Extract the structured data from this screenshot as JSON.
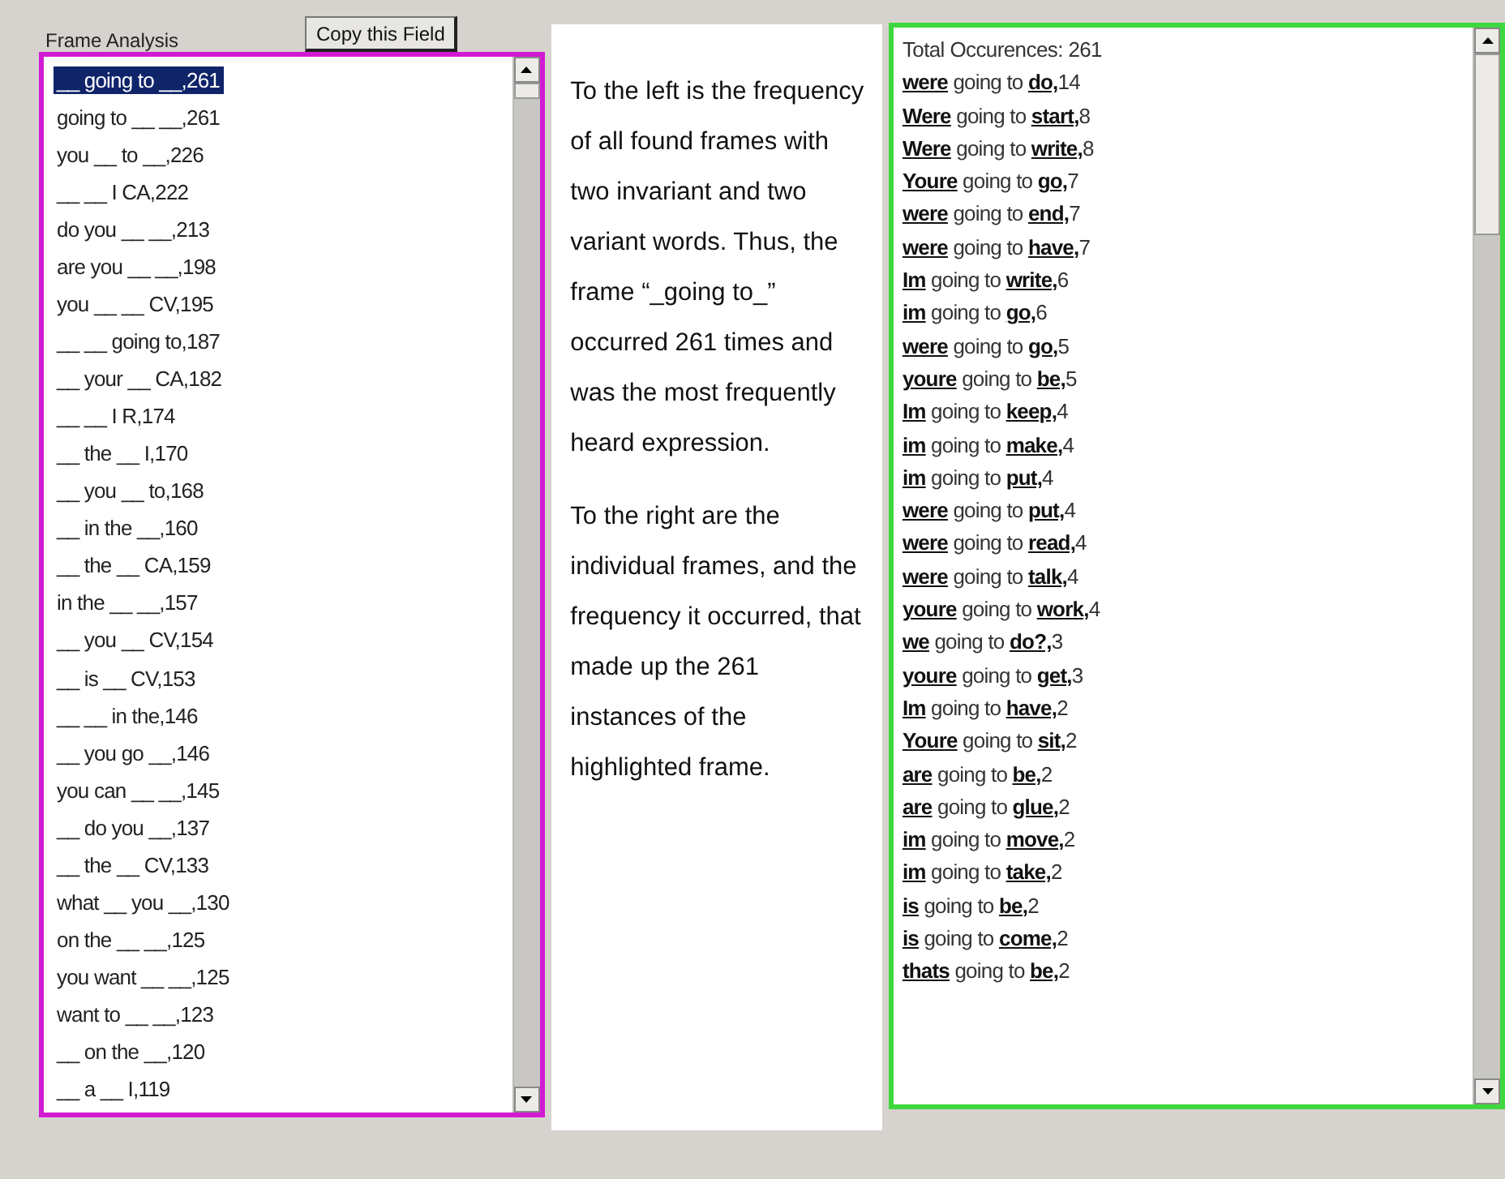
{
  "frame_analysis": {
    "title": "Frame Analysis",
    "copy_button": "Copy this Field",
    "frames": [
      {
        "text": "__ going to __,261",
        "selected": true
      },
      {
        "text": "going to __ __,261",
        "selected": false
      },
      {
        "text": "you __ to __,226",
        "selected": false
      },
      {
        "text": "__ __ I CA,222",
        "selected": false
      },
      {
        "text": "do you __ __,213",
        "selected": false
      },
      {
        "text": "are you __ __,198",
        "selected": false
      },
      {
        "text": "you __ __ CV,195",
        "selected": false
      },
      {
        "text": "__ __ going to,187",
        "selected": false
      },
      {
        "text": "__ your __ CA,182",
        "selected": false
      },
      {
        "text": "__ __ I R,174",
        "selected": false
      },
      {
        "text": "__ the __ I,170",
        "selected": false
      },
      {
        "text": "__ you __ to,168",
        "selected": false
      },
      {
        "text": "__ in the __,160",
        "selected": false
      },
      {
        "text": "__ the __ CA,159",
        "selected": false
      },
      {
        "text": "in the __ __,157",
        "selected": false
      },
      {
        "text": "__ you __ CV,154",
        "selected": false
      },
      {
        "text": "__ is __ CV,153",
        "selected": false
      },
      {
        "text": "__ __ in the,146",
        "selected": false
      },
      {
        "text": "__ you go __,146",
        "selected": false
      },
      {
        "text": "you can __ __,145",
        "selected": false
      },
      {
        "text": "__ do you __,137",
        "selected": false
      },
      {
        "text": "__ the __ CV,133",
        "selected": false
      },
      {
        "text": "what __ you __,130",
        "selected": false
      },
      {
        "text": "on the __ __,125",
        "selected": false
      },
      {
        "text": "you want __ __,125",
        "selected": false
      },
      {
        "text": "want to __ __,123",
        "selected": false
      },
      {
        "text": "__ on the __,120",
        "selected": false
      },
      {
        "text": "__ a __ I,119",
        "selected": false
      }
    ]
  },
  "explanation": [
    "To the left is the frequency of all found frames with two invariant and two variant words. Thus, the frame “_going to_” occurred 261 times and was the most frequently heard expression.",
    "To the right are the individual frames, and the frequency it occurred, that made up the 261 instances of the highlighted frame."
  ],
  "instances": {
    "total": "Total Occurences: 261",
    "rows": [
      {
        "subject": "were",
        "middle": "going to",
        "object": "do,",
        "count": "14"
      },
      {
        "subject": "Were",
        "middle": "going to",
        "object": "start,",
        "count": "8"
      },
      {
        "subject": "Were",
        "middle": "going to",
        "object": "write,",
        "count": "8"
      },
      {
        "subject": "Youre",
        "middle": "going to",
        "object": "go,",
        "count": "7"
      },
      {
        "subject": "were",
        "middle": "going to",
        "object": "end,",
        "count": "7"
      },
      {
        "subject": "were",
        "middle": "going to",
        "object": "have,",
        "count": "7"
      },
      {
        "subject": "Im",
        "middle": "going to",
        "object": "write,",
        "count": "6"
      },
      {
        "subject": "im",
        "middle": "going to",
        "object": "go,",
        "count": "6"
      },
      {
        "subject": "were",
        "middle": "going to",
        "object": "go,",
        "count": "5"
      },
      {
        "subject": "youre",
        "middle": "going to",
        "object": "be,",
        "count": "5"
      },
      {
        "subject": "Im",
        "middle": "going to",
        "object": "keep,",
        "count": "4"
      },
      {
        "subject": "im",
        "middle": "going to",
        "object": "make,",
        "count": "4"
      },
      {
        "subject": "im",
        "middle": "going to",
        "object": "put,",
        "count": "4"
      },
      {
        "subject": "were",
        "middle": "going to",
        "object": "put,",
        "count": "4"
      },
      {
        "subject": "were",
        "middle": "going to",
        "object": "read,",
        "count": "4"
      },
      {
        "subject": "were",
        "middle": "going to",
        "object": "talk,",
        "count": "4"
      },
      {
        "subject": "youre",
        "middle": "going to",
        "object": "work,",
        "count": "4"
      },
      {
        "subject": "we",
        "middle": "going to",
        "object": "do?,",
        "count": "3"
      },
      {
        "subject": "youre",
        "middle": "going to",
        "object": "get,",
        "count": "3"
      },
      {
        "subject": "Im",
        "middle": "going to",
        "object": "have,",
        "count": "2"
      },
      {
        "subject": "Youre",
        "middle": "going to",
        "object": "sit,",
        "count": "2"
      },
      {
        "subject": "are",
        "middle": "going to",
        "object": "be,",
        "count": "2"
      },
      {
        "subject": "are",
        "middle": "going to",
        "object": "glue,",
        "count": "2"
      },
      {
        "subject": "im",
        "middle": "going to",
        "object": "move,",
        "count": "2"
      },
      {
        "subject": "im",
        "middle": "going to",
        "object": "take,",
        "count": "2"
      },
      {
        "subject": "is",
        "middle": "going to",
        "object": "be,",
        "count": "2"
      },
      {
        "subject": "is",
        "middle": "going to",
        "object": "come,",
        "count": "2"
      },
      {
        "subject": "thats",
        "middle": "going to",
        "object": "be,",
        "count": "2"
      }
    ]
  }
}
